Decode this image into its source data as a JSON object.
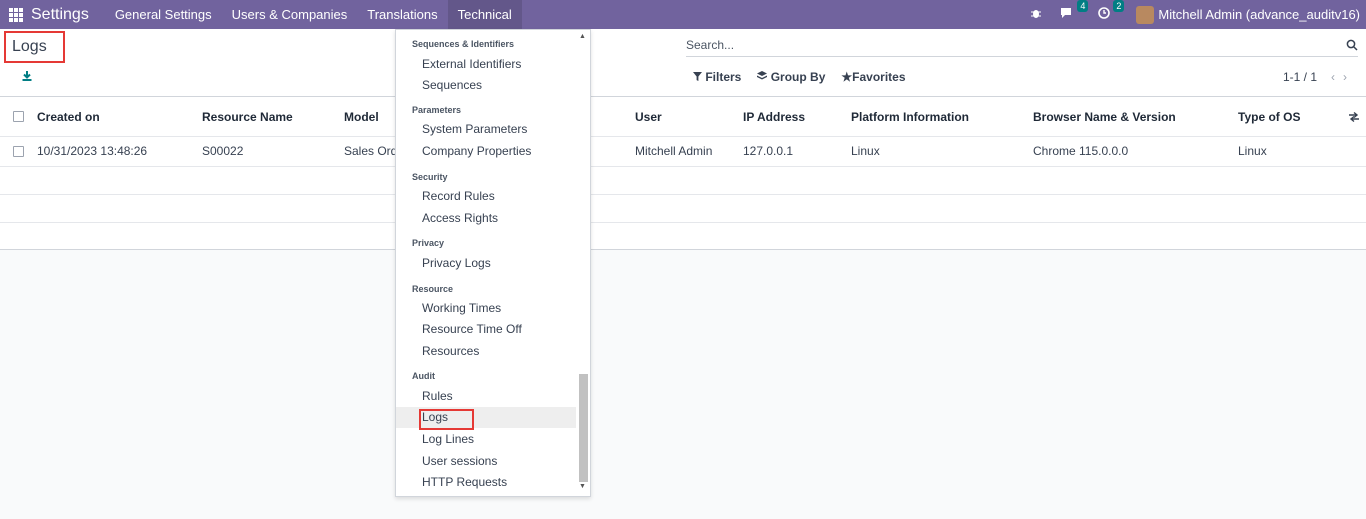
{
  "navbar": {
    "app_name": "Settings",
    "menu": [
      "General Settings",
      "Users & Companies",
      "Translations",
      "Technical"
    ],
    "messages_count": "4",
    "activities_count": "2",
    "user": "Mitchell Admin (advance_auditv16)"
  },
  "page": {
    "title": "Logs"
  },
  "search": {
    "placeholder": "Search..."
  },
  "filters": {
    "filters": "Filters",
    "group_by": "Group By",
    "favorites": "Favorites"
  },
  "pager": {
    "label": "1-1 / 1"
  },
  "table": {
    "headers": [
      "Created on",
      "Resource Name",
      "Model",
      "User",
      "IP Address",
      "Platform Information",
      "Browser Name & Version",
      "Type of OS"
    ],
    "rows": [
      [
        "10/31/2023 13:48:26",
        "S00022",
        "Sales Orde",
        "Mitchell Admin",
        "127.0.0.1",
        "Linux",
        "Chrome 115.0.0.0",
        "Linux"
      ]
    ]
  },
  "dropdown": {
    "sections": {
      "sequences": "Sequences & Identifiers",
      "parameters": "Parameters",
      "security": "Security",
      "privacy": "Privacy",
      "resource": "Resource",
      "audit": "Audit"
    },
    "items": {
      "external_identifiers": "External Identifiers",
      "sequences": "Sequences",
      "system_parameters": "System Parameters",
      "company_properties": "Company Properties",
      "record_rules": "Record Rules",
      "access_rights": "Access Rights",
      "privacy_logs": "Privacy Logs",
      "working_times": "Working Times",
      "resource_time_off": "Resource Time Off",
      "resources": "Resources",
      "rules": "Rules",
      "logs": "Logs",
      "log_lines": "Log Lines",
      "user_sessions": "User sessions",
      "http_requests": "HTTP Requests"
    }
  },
  "colors": {
    "navbar": "#71639e",
    "highlight_box": "#e53935",
    "badge": "#017e84"
  }
}
